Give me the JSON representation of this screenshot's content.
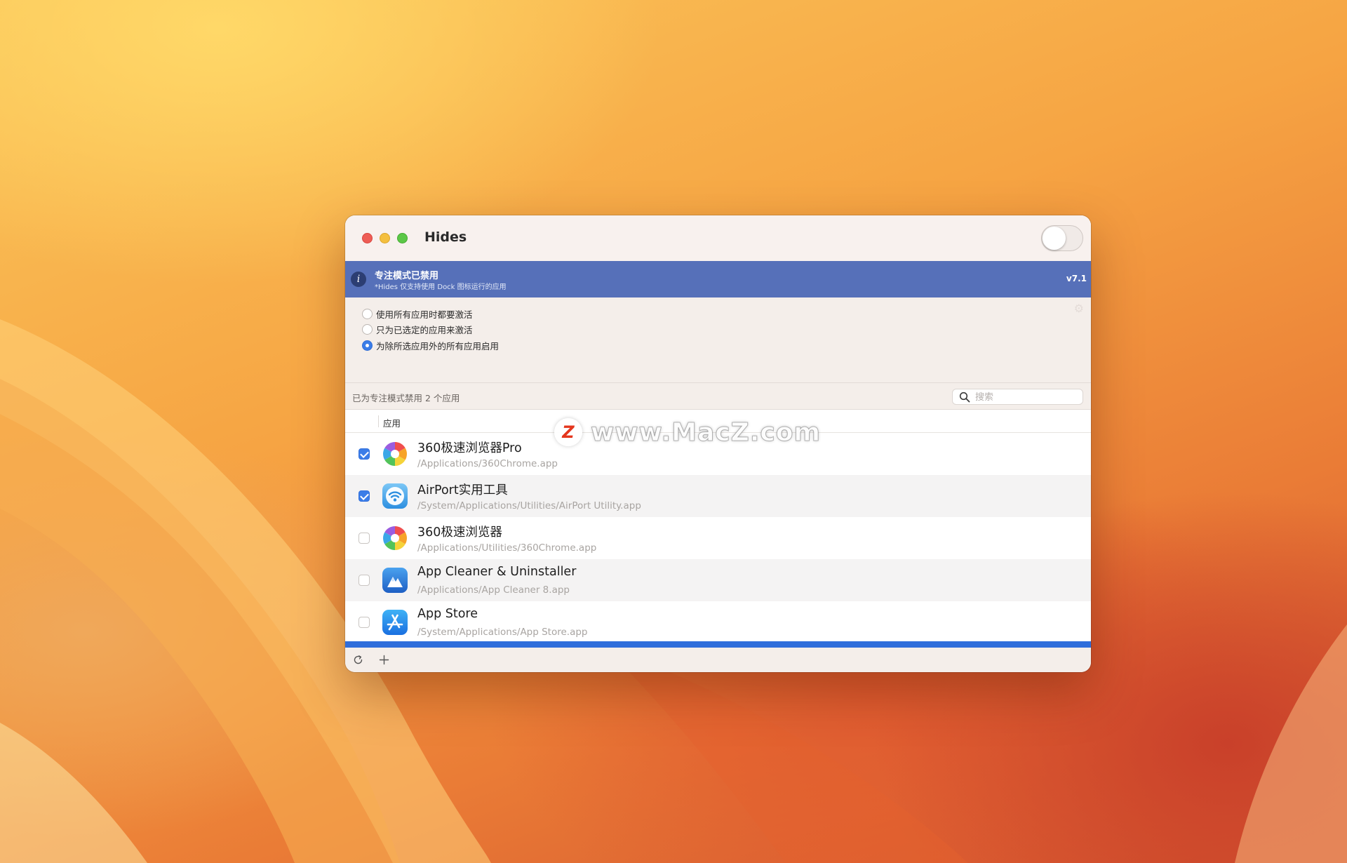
{
  "window": {
    "title": "Hides",
    "main_toggle_on": false
  },
  "banner": {
    "title": "专注模式已禁用",
    "subtitle": "*Hides 仅支持使用 Dock 图标运行的应用",
    "version": "v7.1",
    "info_icon_glyph": "i",
    "color": "#5670b9"
  },
  "options": [
    {
      "label": "使用所有应用时都要激活",
      "selected": false
    },
    {
      "label": "只为已选定的应用来激活",
      "selected": false
    },
    {
      "label": "为除所选应用外的所有应用启用",
      "selected": true
    }
  ],
  "filter": {
    "count_text": "已为专注模式禁用 2 个应用",
    "search_placeholder": "搜索",
    "search_value": ""
  },
  "table": {
    "column_header": "应用",
    "rows": [
      {
        "name": "360极速浏览器Pro",
        "path": "/Applications/360Chrome.app",
        "checked": true,
        "icon": "360-browser-icon"
      },
      {
        "name": "AirPort实用工具",
        "path": "/System/Applications/Utilities/AirPort Utility.app",
        "checked": true,
        "icon": "airport-utility-icon"
      },
      {
        "name": "360极速浏览器",
        "path": "/Applications/Utilities/360Chrome.app",
        "checked": false,
        "icon": "360-browser-icon"
      },
      {
        "name": "App Cleaner & Uninstaller",
        "path": "/Applications/App Cleaner 8.app",
        "checked": false,
        "icon": "app-cleaner-icon"
      },
      {
        "name": "App Store",
        "path": "/System/Applications/App Store.app",
        "checked": false,
        "icon": "app-store-icon"
      }
    ]
  },
  "bottom_bar": {
    "icons": [
      "refresh-icon",
      "plus-icon"
    ]
  },
  "watermark": {
    "logo_letter": "Z",
    "text": "www.MacZ.com"
  },
  "colors": {
    "accent": "#3b7de8",
    "selection_bar": "#2f6ddb"
  }
}
